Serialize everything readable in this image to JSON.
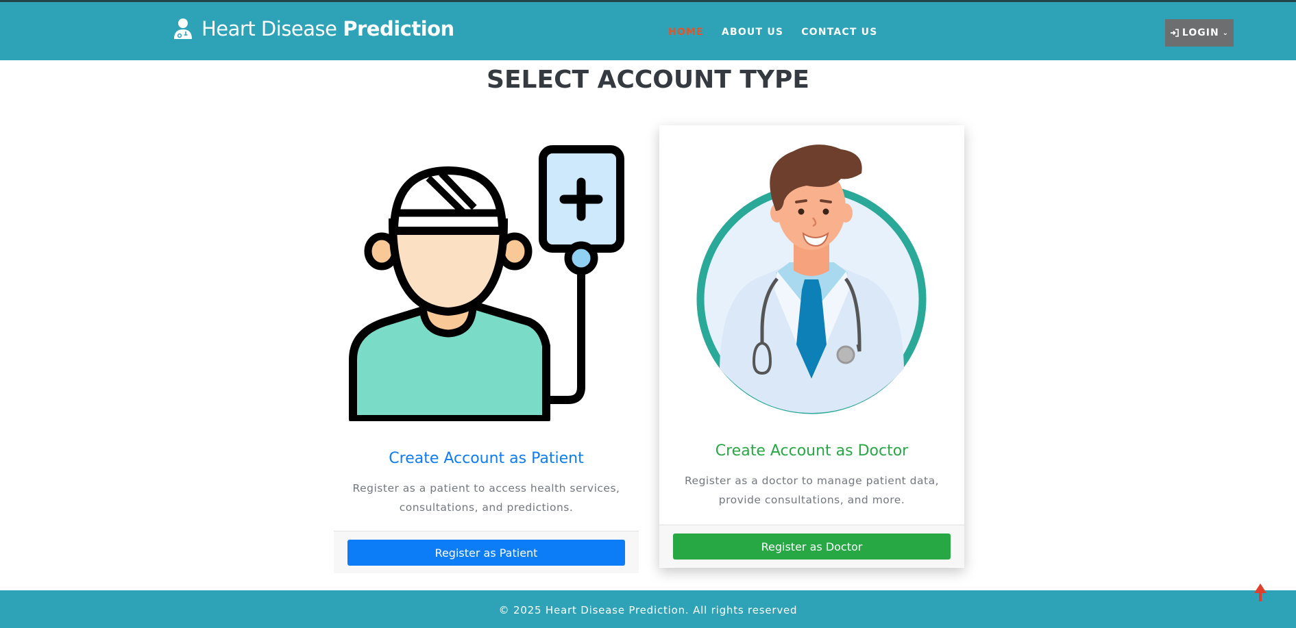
{
  "header": {
    "brand_light": "Heart Disease ",
    "brand_bold": "Prediction",
    "nav": {
      "home": "HOME",
      "about": "ABOUT US",
      "contact": "CONTACT US"
    },
    "login_label": "LOGIN"
  },
  "main": {
    "title": "SELECT ACCOUNT TYPE",
    "patient_card": {
      "title": "Create Account as Patient",
      "desc_line1": "Register as a patient to access health services,",
      "desc_line2": "consultations, and predictions.",
      "button": "Register as Patient",
      "accent": "#0d7cf7"
    },
    "doctor_card": {
      "title": "Create Account as Doctor",
      "desc_line1": "Register as a doctor to manage patient data,",
      "desc_line2": "provide consultations, and more.",
      "button": "Register as Doctor",
      "accent": "#28a745"
    }
  },
  "footer": {
    "text": "© 2025 Heart Disease Prediction. All rights reserved"
  },
  "colors": {
    "header_bg": "#2ea3b7",
    "active_nav": "#e0562b",
    "login_bg": "#6d6e70"
  },
  "icons": {
    "brand": "doctor-user-icon",
    "login": "sign-in-icon",
    "dropdown": "chevron-down-icon",
    "scroll_top": "arrow-up-icon"
  }
}
